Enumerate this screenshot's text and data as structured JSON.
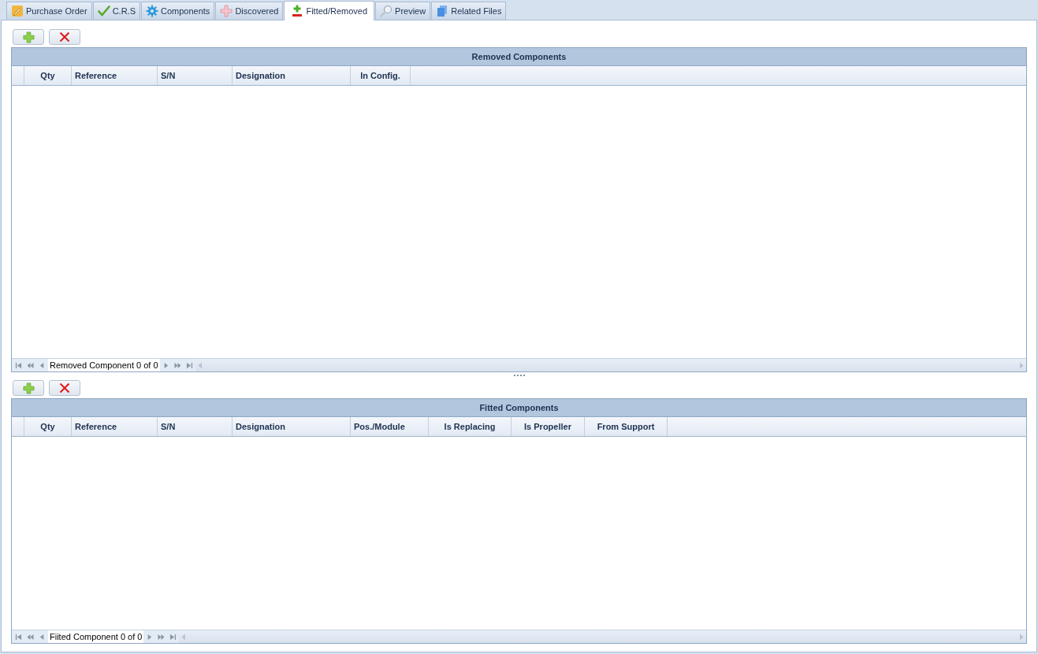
{
  "tabs": [
    {
      "label": "Purchase Order",
      "selected": false
    },
    {
      "label": "C.R.S",
      "selected": false
    },
    {
      "label": "Components",
      "selected": false
    },
    {
      "label": "Discovered",
      "selected": false
    },
    {
      "label": "Fitted/Removed",
      "selected": true
    },
    {
      "label": "Preview",
      "selected": false
    },
    {
      "label": "Related Files",
      "selected": false
    }
  ],
  "removed_grid": {
    "title": "Removed Components",
    "columns": [
      "Qty",
      "Reference",
      "S/N",
      "Designation",
      "In Config."
    ],
    "navigator": "Removed Component 0 of 0"
  },
  "fitted_grid": {
    "title": "Fitted Components",
    "columns": [
      "Qty",
      "Reference",
      "S/N",
      "Designation",
      "Pos./Module",
      "Is Replacing",
      "Is Propeller",
      "From Support"
    ],
    "navigator": "Fiited Component 0 of 0"
  }
}
